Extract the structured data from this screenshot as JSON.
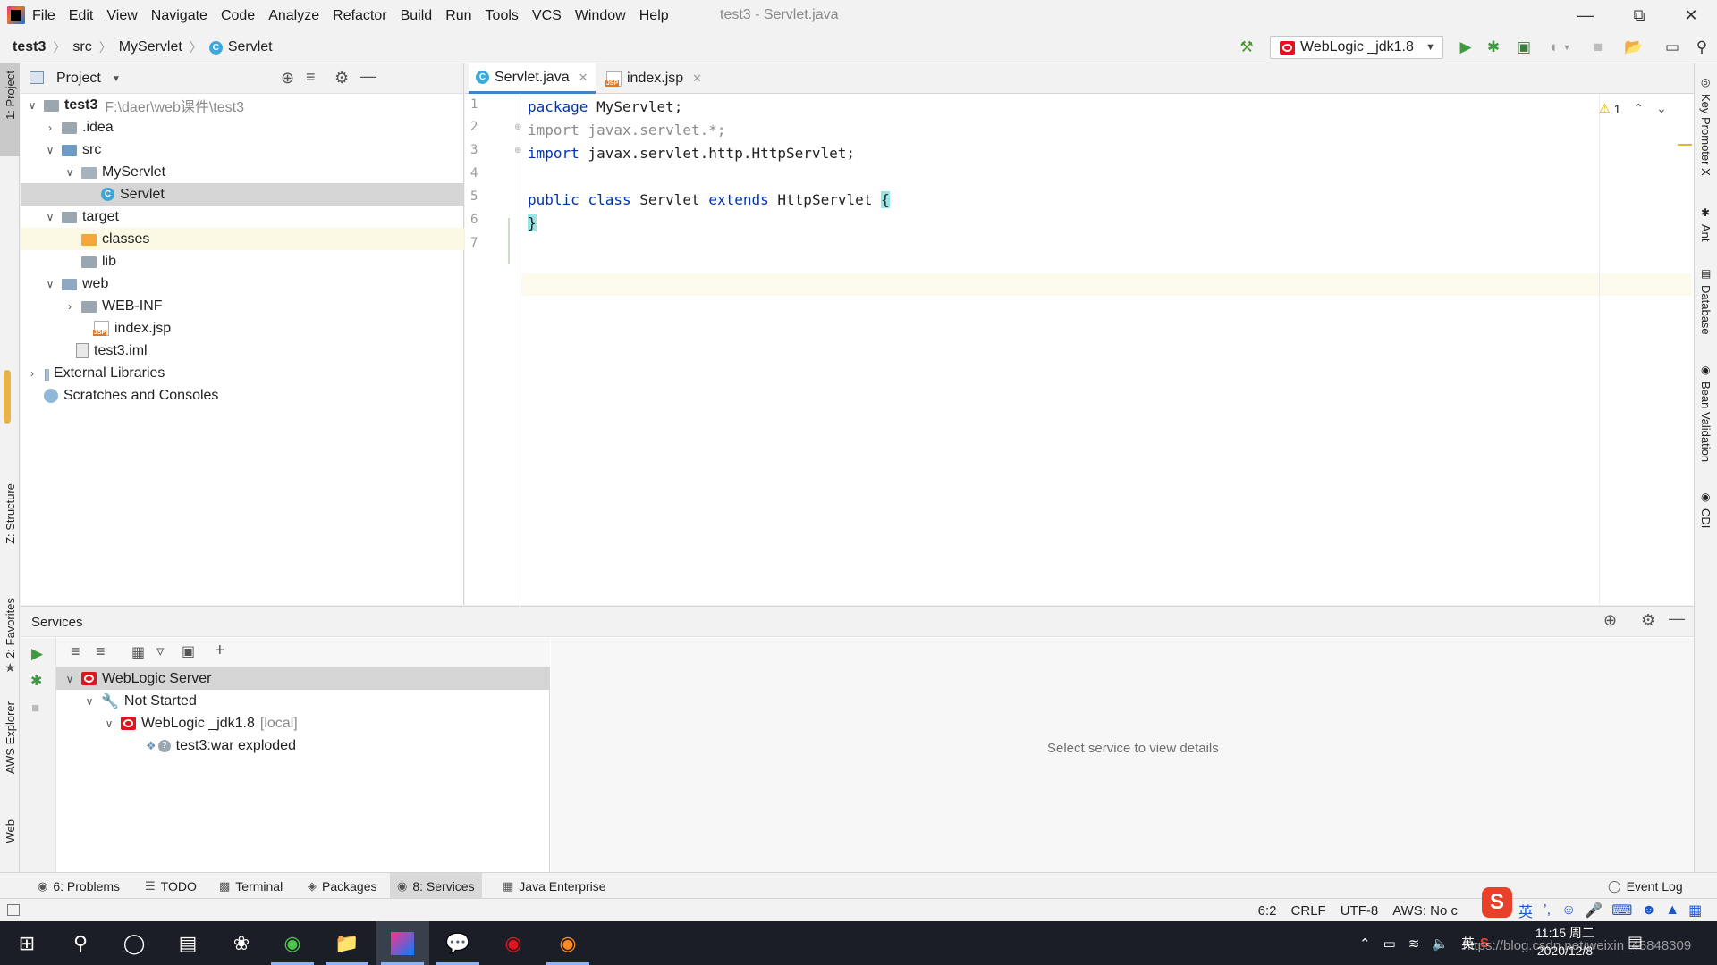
{
  "menubar": {
    "items": [
      "File",
      "Edit",
      "View",
      "Navigate",
      "Code",
      "Analyze",
      "Refactor",
      "Build",
      "Run",
      "Tools",
      "VCS",
      "Window",
      "Help"
    ],
    "window_title": "test3 - Servlet.java"
  },
  "navbar": {
    "crumbs": [
      "test3",
      "src",
      "MyServlet",
      "Servlet"
    ],
    "run_config": "WebLogic _jdk1.8"
  },
  "left_strip": {
    "project": "1: Project",
    "structure": "Z: Structure",
    "favorites": "2: Favorites",
    "aws": "AWS Explorer",
    "web": "Web"
  },
  "right_strip": {
    "key_promoter": "Key Promoter X",
    "ant": "Ant",
    "database": "Database",
    "bean_validation": "Bean Validation",
    "cdi": "CDI"
  },
  "project": {
    "title": "Project",
    "tree": [
      {
        "label": "test3",
        "extra": "F:\\daer\\web课件\\test3",
        "depth": 0
      },
      {
        "label": ".idea",
        "depth": 1
      },
      {
        "label": "src",
        "depth": 1
      },
      {
        "label": "MyServlet",
        "depth": 2
      },
      {
        "label": "Servlet",
        "depth": 3
      },
      {
        "label": "target",
        "depth": 1
      },
      {
        "label": "classes",
        "depth": 2
      },
      {
        "label": "lib",
        "depth": 2
      },
      {
        "label": "web",
        "depth": 1
      },
      {
        "label": "WEB-INF",
        "depth": 2
      },
      {
        "label": "index.jsp",
        "depth": 2
      },
      {
        "label": "test3.iml",
        "depth": 1
      },
      {
        "label": "External Libraries",
        "depth": 0
      },
      {
        "label": "Scratches and Consoles",
        "depth": 0
      }
    ]
  },
  "editor": {
    "tabs": [
      "Servlet.java",
      "index.jsp"
    ],
    "warning_count": "1",
    "line_numbers": [
      "1",
      "2",
      "3",
      "4",
      "5",
      "6",
      "7"
    ],
    "code": {
      "l1_kw": "package",
      "l1_rest": " MyServlet;",
      "l2": "import javax.servlet.*;",
      "l3_kw": "import",
      "l3_rest": " javax.servlet.http.HttpServlet;",
      "l5_kw1": "public",
      "l5_kw2": "class",
      "l5_name": "Servlet",
      "l5_kw3": "extends",
      "l5_super": "HttpServlet",
      "l5_brace": "{",
      "l6_brace": "}"
    }
  },
  "services": {
    "title": "Services",
    "tree": [
      {
        "label": "WebLogic Server",
        "depth": 0
      },
      {
        "label": "Not Started",
        "depth": 1
      },
      {
        "label": "WebLogic _jdk1.8",
        "extra": "[local]",
        "depth": 2
      },
      {
        "label": "test3:war exploded",
        "depth": 3
      }
    ],
    "detail_placeholder": "Select service to view details"
  },
  "bottom_tabs": {
    "problems": "6: Problems",
    "todo": "TODO",
    "terminal": "Terminal",
    "packages": "Packages",
    "services": "8: Services",
    "java_enterprise": "Java Enterprise",
    "event_log": "Event Log"
  },
  "statusbar": {
    "position": "6:2",
    "line_sep": "CRLF",
    "encoding": "UTF-8",
    "aws": "AWS: No c"
  },
  "taskbar": {
    "time": "11:15 周二",
    "date": "2020/12/8",
    "ime_lang": "英",
    "ime_lang2": "英",
    "watermark": "https://blog.csdn.net/weixin_45848309"
  },
  "colors": {
    "keyword": "#0033b3",
    "comment": "#8c8c8c",
    "selection": "#d5d5d5",
    "accent_tab": "#4083c9",
    "weblogic_red": "#e0141c"
  }
}
